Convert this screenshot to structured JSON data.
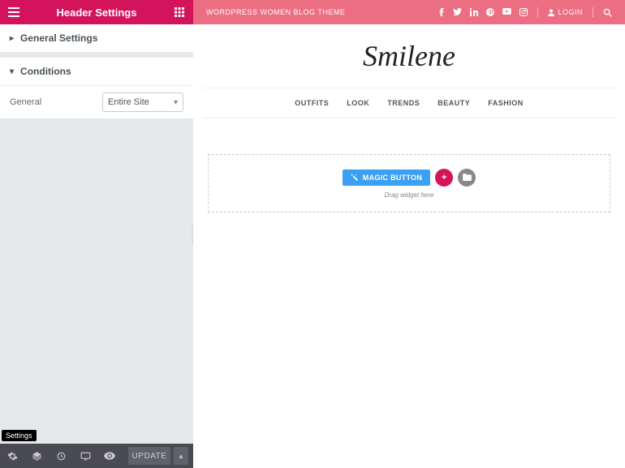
{
  "sidebar": {
    "title": "Header Settings",
    "accordion": {
      "general_settings": "General Settings",
      "conditions": "Conditions"
    },
    "condition_row": {
      "label": "General",
      "value": "Entire Site"
    },
    "tooltip": "Settings",
    "footer": {
      "update": "UPDATE"
    }
  },
  "preview": {
    "topbar": {
      "tagline": "WORDPRESS WOMEN BLOG THEME",
      "login": "LOGIN"
    },
    "logo": "Smilene",
    "nav": [
      "OUTFITS",
      "LOOK",
      "TRENDS",
      "BEAUTY",
      "FASHION"
    ],
    "dropzone": {
      "magic_button": "MAGIC BUTTON",
      "hint": "Drag widget here"
    }
  }
}
